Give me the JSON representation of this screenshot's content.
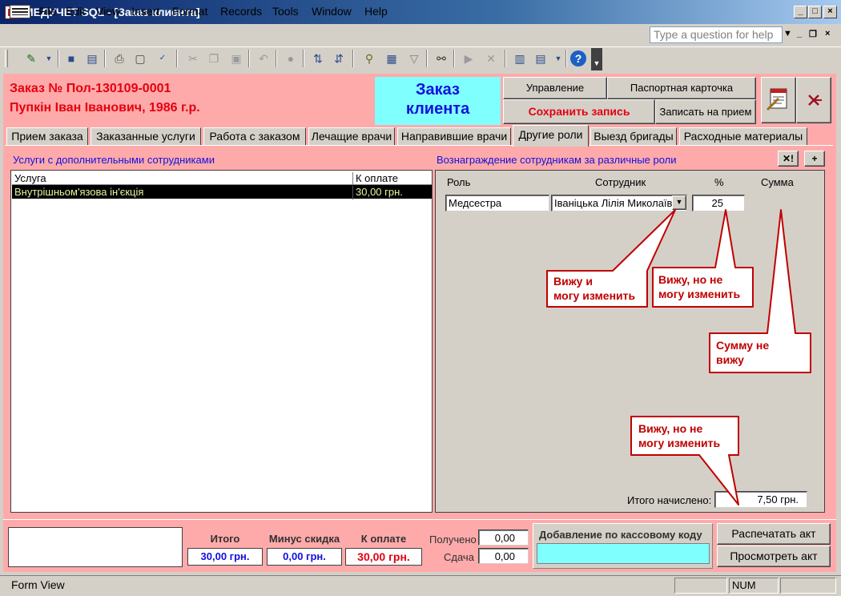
{
  "window": {
    "title": "МЕДУЧЕТ SQL - [Заказ клиента]",
    "minimize": "_",
    "maximize": "□",
    "close": "×"
  },
  "menu": {
    "items": [
      "File",
      "Edit",
      "View",
      "Insert",
      "Format",
      "Records",
      "Tools",
      "Window",
      "Help"
    ],
    "ask_placeholder": "Type a question for help"
  },
  "header": {
    "order_number": "Заказ №  Пол-130109-0001",
    "patient": "Пупкін Іван Іванович, 1986 г.р.",
    "title": "Заказ клиента",
    "buttons": {
      "manage": "Управление",
      "passport": "Паспортная карточка",
      "save": "Сохранить запись",
      "appointment": "Записать на прием"
    }
  },
  "tabs": [
    {
      "label": "Прием заказа",
      "active": false
    },
    {
      "label": "Заказанные услуги",
      "active": false
    },
    {
      "label": "Работа с заказом",
      "active": false
    },
    {
      "label": "Лечащие врачи",
      "active": false
    },
    {
      "label": "Направившие врачи",
      "active": false
    },
    {
      "label": "Другие роли",
      "active": true
    },
    {
      "label": "Выезд бригады",
      "active": false
    },
    {
      "label": "Расходные материалы",
      "active": false
    }
  ],
  "services": {
    "section_label": "Услуги с дополнительными сотрудниками",
    "columns": [
      "Услуга",
      "К оплате"
    ],
    "rows": [
      {
        "service": "Внутрішньом'язова ін'єкція",
        "amount": "30,00 грн."
      }
    ]
  },
  "rewards": {
    "section_label": "Вознаграждение сотрудникам за различные роли",
    "delete_btn": "✕!",
    "add_btn": "+",
    "columns": {
      "role": "Роль",
      "employee": "Сотрудник",
      "percent": "%",
      "sum": "Сумма"
    },
    "row": {
      "role": "Медсестра",
      "employee": "Іваніцька Лілія Миколаїв",
      "percent": "25"
    },
    "total_label": "Итого начислено:",
    "total_value": "7,50 грн."
  },
  "callouts": {
    "can_edit": [
      "Вижу и",
      "могу изменить"
    ],
    "cannot_edit_percent": [
      "Вижу, но не",
      "могу изменить"
    ],
    "sum_hidden": [
      "Сумму не",
      "вижу"
    ],
    "cannot_edit_total": [
      "Вижу, но не",
      "могу изменить"
    ]
  },
  "footer": {
    "total_label": "Итого",
    "total_value": "30,00 грн.",
    "discount_label": "Минус скидка",
    "discount_value": "0,00 грн.",
    "payable_label": "К оплате",
    "payable_value": "30,00 грн.",
    "received_label": "Получено",
    "received_value": "0,00",
    "change_label": "Сдача",
    "change_value": "0,00",
    "cash_code_label": "Добавление по кассовому коду",
    "print_act": "Распечатать акт",
    "view_act": "Просмотреть акт"
  },
  "status": {
    "view": "Form View",
    "num": "NUM"
  },
  "colors": {
    "form_bg": "#ffaaaa",
    "accent_red": "#e4000f",
    "header_cyan": "#80ffff",
    "blue_text": "#1010e0",
    "callout_red": "#c00000"
  }
}
